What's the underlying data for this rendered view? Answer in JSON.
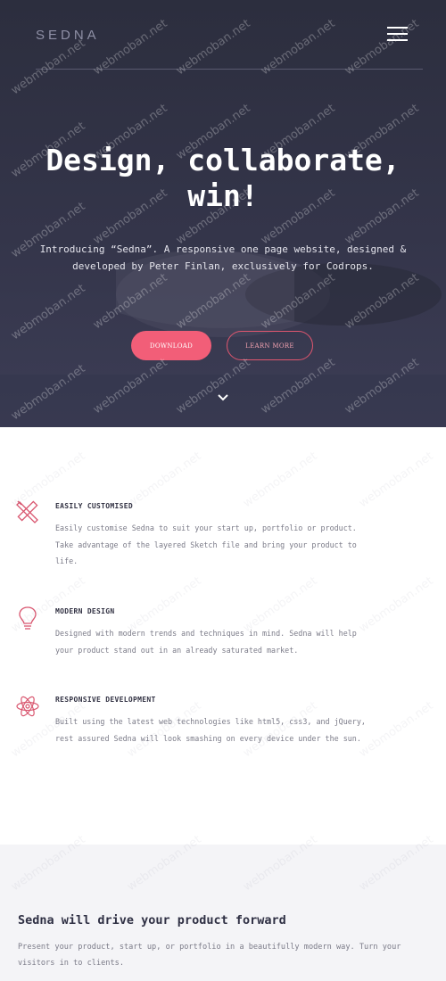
{
  "header": {
    "logo": "SEDNA",
    "menu_icon": "hamburger-menu-icon"
  },
  "hero": {
    "title_line1": "Design, collaborate,",
    "title_line2": "win!",
    "subtitle_line1": "Introducing “Sedna”. A responsive one page website, designed &",
    "subtitle_line2": "developed by Peter Finlan, exclusively for Codrops.",
    "download_label": "DOWNLOAD",
    "learn_more_label": "LEARN MORE",
    "scroll_icon": "chevron-down-icon"
  },
  "features": [
    {
      "icon": "pencil-ruler-icon",
      "title": "EASILY CUSTOMISED",
      "text": "Easily customise Sedna to suit your start up, portfolio or product. Take advantage of the layered Sketch file and bring your product to life."
    },
    {
      "icon": "lightbulb-icon",
      "title": "MODERN DESIGN",
      "text": "Designed with modern trends and techniques in mind. Sedna will help your product stand out in an already saturated market."
    },
    {
      "icon": "atom-icon",
      "title": "RESPONSIVE DEVELOPMENT",
      "text": "Built using the latest web technologies like html5, css3, and jQuery, rest assured Sedna will look smashing on every device under the sun."
    }
  ],
  "band": {
    "title": "Sedna will drive your product forward",
    "text": "Present your product, start up, or portfolio in a beautifully modern way. Turn your visitors in to clients."
  },
  "watermark": "webmoban.net",
  "colors": {
    "accent": "#f25e78",
    "hero_bg": "#2c2e3e",
    "icon_stroke": "#d9566f"
  }
}
